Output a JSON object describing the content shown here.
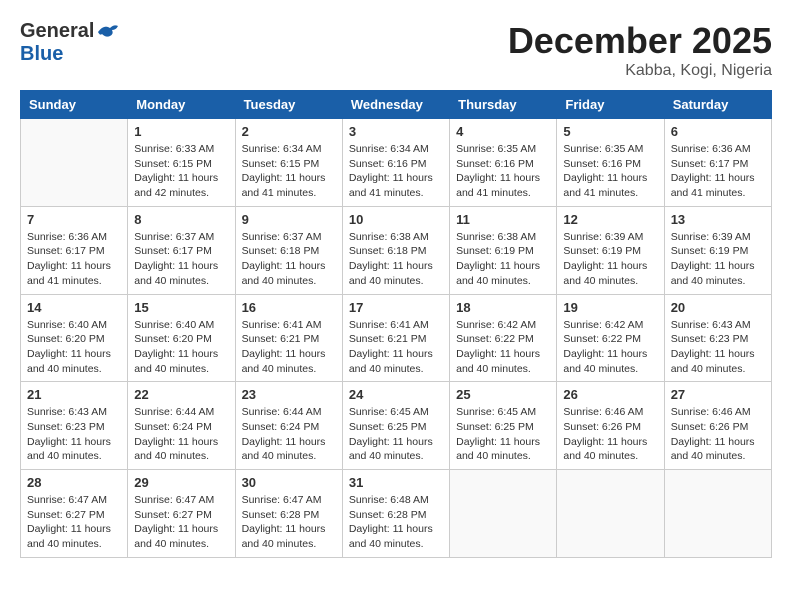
{
  "logo": {
    "general": "General",
    "blue": "Blue"
  },
  "title": "December 2025",
  "location": "Kabba, Kogi, Nigeria",
  "headers": [
    "Sunday",
    "Monday",
    "Tuesday",
    "Wednesday",
    "Thursday",
    "Friday",
    "Saturday"
  ],
  "weeks": [
    [
      {
        "day": "",
        "sunrise": "",
        "sunset": "",
        "daylight": ""
      },
      {
        "day": "1",
        "sunrise": "Sunrise: 6:33 AM",
        "sunset": "Sunset: 6:15 PM",
        "daylight": "Daylight: 11 hours and 42 minutes."
      },
      {
        "day": "2",
        "sunrise": "Sunrise: 6:34 AM",
        "sunset": "Sunset: 6:15 PM",
        "daylight": "Daylight: 11 hours and 41 minutes."
      },
      {
        "day": "3",
        "sunrise": "Sunrise: 6:34 AM",
        "sunset": "Sunset: 6:16 PM",
        "daylight": "Daylight: 11 hours and 41 minutes."
      },
      {
        "day": "4",
        "sunrise": "Sunrise: 6:35 AM",
        "sunset": "Sunset: 6:16 PM",
        "daylight": "Daylight: 11 hours and 41 minutes."
      },
      {
        "day": "5",
        "sunrise": "Sunrise: 6:35 AM",
        "sunset": "Sunset: 6:16 PM",
        "daylight": "Daylight: 11 hours and 41 minutes."
      },
      {
        "day": "6",
        "sunrise": "Sunrise: 6:36 AM",
        "sunset": "Sunset: 6:17 PM",
        "daylight": "Daylight: 11 hours and 41 minutes."
      }
    ],
    [
      {
        "day": "7",
        "sunrise": "Sunrise: 6:36 AM",
        "sunset": "Sunset: 6:17 PM",
        "daylight": "Daylight: 11 hours and 41 minutes."
      },
      {
        "day": "8",
        "sunrise": "Sunrise: 6:37 AM",
        "sunset": "Sunset: 6:17 PM",
        "daylight": "Daylight: 11 hours and 40 minutes."
      },
      {
        "day": "9",
        "sunrise": "Sunrise: 6:37 AM",
        "sunset": "Sunset: 6:18 PM",
        "daylight": "Daylight: 11 hours and 40 minutes."
      },
      {
        "day": "10",
        "sunrise": "Sunrise: 6:38 AM",
        "sunset": "Sunset: 6:18 PM",
        "daylight": "Daylight: 11 hours and 40 minutes."
      },
      {
        "day": "11",
        "sunrise": "Sunrise: 6:38 AM",
        "sunset": "Sunset: 6:19 PM",
        "daylight": "Daylight: 11 hours and 40 minutes."
      },
      {
        "day": "12",
        "sunrise": "Sunrise: 6:39 AM",
        "sunset": "Sunset: 6:19 PM",
        "daylight": "Daylight: 11 hours and 40 minutes."
      },
      {
        "day": "13",
        "sunrise": "Sunrise: 6:39 AM",
        "sunset": "Sunset: 6:19 PM",
        "daylight": "Daylight: 11 hours and 40 minutes."
      }
    ],
    [
      {
        "day": "14",
        "sunrise": "Sunrise: 6:40 AM",
        "sunset": "Sunset: 6:20 PM",
        "daylight": "Daylight: 11 hours and 40 minutes."
      },
      {
        "day": "15",
        "sunrise": "Sunrise: 6:40 AM",
        "sunset": "Sunset: 6:20 PM",
        "daylight": "Daylight: 11 hours and 40 minutes."
      },
      {
        "day": "16",
        "sunrise": "Sunrise: 6:41 AM",
        "sunset": "Sunset: 6:21 PM",
        "daylight": "Daylight: 11 hours and 40 minutes."
      },
      {
        "day": "17",
        "sunrise": "Sunrise: 6:41 AM",
        "sunset": "Sunset: 6:21 PM",
        "daylight": "Daylight: 11 hours and 40 minutes."
      },
      {
        "day": "18",
        "sunrise": "Sunrise: 6:42 AM",
        "sunset": "Sunset: 6:22 PM",
        "daylight": "Daylight: 11 hours and 40 minutes."
      },
      {
        "day": "19",
        "sunrise": "Sunrise: 6:42 AM",
        "sunset": "Sunset: 6:22 PM",
        "daylight": "Daylight: 11 hours and 40 minutes."
      },
      {
        "day": "20",
        "sunrise": "Sunrise: 6:43 AM",
        "sunset": "Sunset: 6:23 PM",
        "daylight": "Daylight: 11 hours and 40 minutes."
      }
    ],
    [
      {
        "day": "21",
        "sunrise": "Sunrise: 6:43 AM",
        "sunset": "Sunset: 6:23 PM",
        "daylight": "Daylight: 11 hours and 40 minutes."
      },
      {
        "day": "22",
        "sunrise": "Sunrise: 6:44 AM",
        "sunset": "Sunset: 6:24 PM",
        "daylight": "Daylight: 11 hours and 40 minutes."
      },
      {
        "day": "23",
        "sunrise": "Sunrise: 6:44 AM",
        "sunset": "Sunset: 6:24 PM",
        "daylight": "Daylight: 11 hours and 40 minutes."
      },
      {
        "day": "24",
        "sunrise": "Sunrise: 6:45 AM",
        "sunset": "Sunset: 6:25 PM",
        "daylight": "Daylight: 11 hours and 40 minutes."
      },
      {
        "day": "25",
        "sunrise": "Sunrise: 6:45 AM",
        "sunset": "Sunset: 6:25 PM",
        "daylight": "Daylight: 11 hours and 40 minutes."
      },
      {
        "day": "26",
        "sunrise": "Sunrise: 6:46 AM",
        "sunset": "Sunset: 6:26 PM",
        "daylight": "Daylight: 11 hours and 40 minutes."
      },
      {
        "day": "27",
        "sunrise": "Sunrise: 6:46 AM",
        "sunset": "Sunset: 6:26 PM",
        "daylight": "Daylight: 11 hours and 40 minutes."
      }
    ],
    [
      {
        "day": "28",
        "sunrise": "Sunrise: 6:47 AM",
        "sunset": "Sunset: 6:27 PM",
        "daylight": "Daylight: 11 hours and 40 minutes."
      },
      {
        "day": "29",
        "sunrise": "Sunrise: 6:47 AM",
        "sunset": "Sunset: 6:27 PM",
        "daylight": "Daylight: 11 hours and 40 minutes."
      },
      {
        "day": "30",
        "sunrise": "Sunrise: 6:47 AM",
        "sunset": "Sunset: 6:28 PM",
        "daylight": "Daylight: 11 hours and 40 minutes."
      },
      {
        "day": "31",
        "sunrise": "Sunrise: 6:48 AM",
        "sunset": "Sunset: 6:28 PM",
        "daylight": "Daylight: 11 hours and 40 minutes."
      },
      {
        "day": "",
        "sunrise": "",
        "sunset": "",
        "daylight": ""
      },
      {
        "day": "",
        "sunrise": "",
        "sunset": "",
        "daylight": ""
      },
      {
        "day": "",
        "sunrise": "",
        "sunset": "",
        "daylight": ""
      }
    ]
  ]
}
